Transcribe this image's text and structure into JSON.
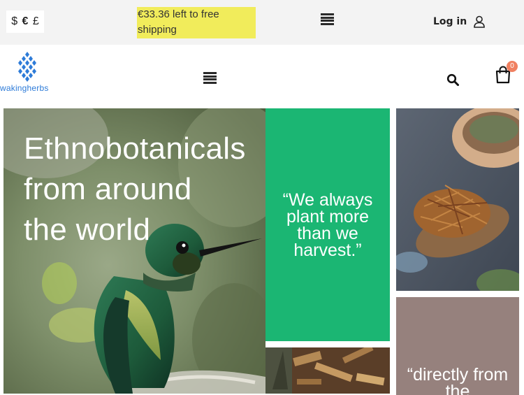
{
  "topbar": {
    "currencies": [
      "$",
      "€",
      "£"
    ],
    "active_currency": "€",
    "shipping_notice": "€33.36 left to free shipping",
    "login_label": "Log in"
  },
  "header": {
    "logo_text": "wakingherbs",
    "cart_count": "0"
  },
  "hero": {
    "title": "Ethnobotanicals\nfrom around\nthe world"
  },
  "quotes": {
    "green": "“We always plant more than we harvest.”",
    "mauve": "“directly from the"
  },
  "colors": {
    "topbar_bg": "#f3f3f3",
    "shipping_highlight": "#f1ec5b",
    "brand_blue": "#2d7bd8",
    "quote_green": "#1bb673",
    "quote_mauve": "#96817d",
    "cart_badge": "#f08060"
  }
}
